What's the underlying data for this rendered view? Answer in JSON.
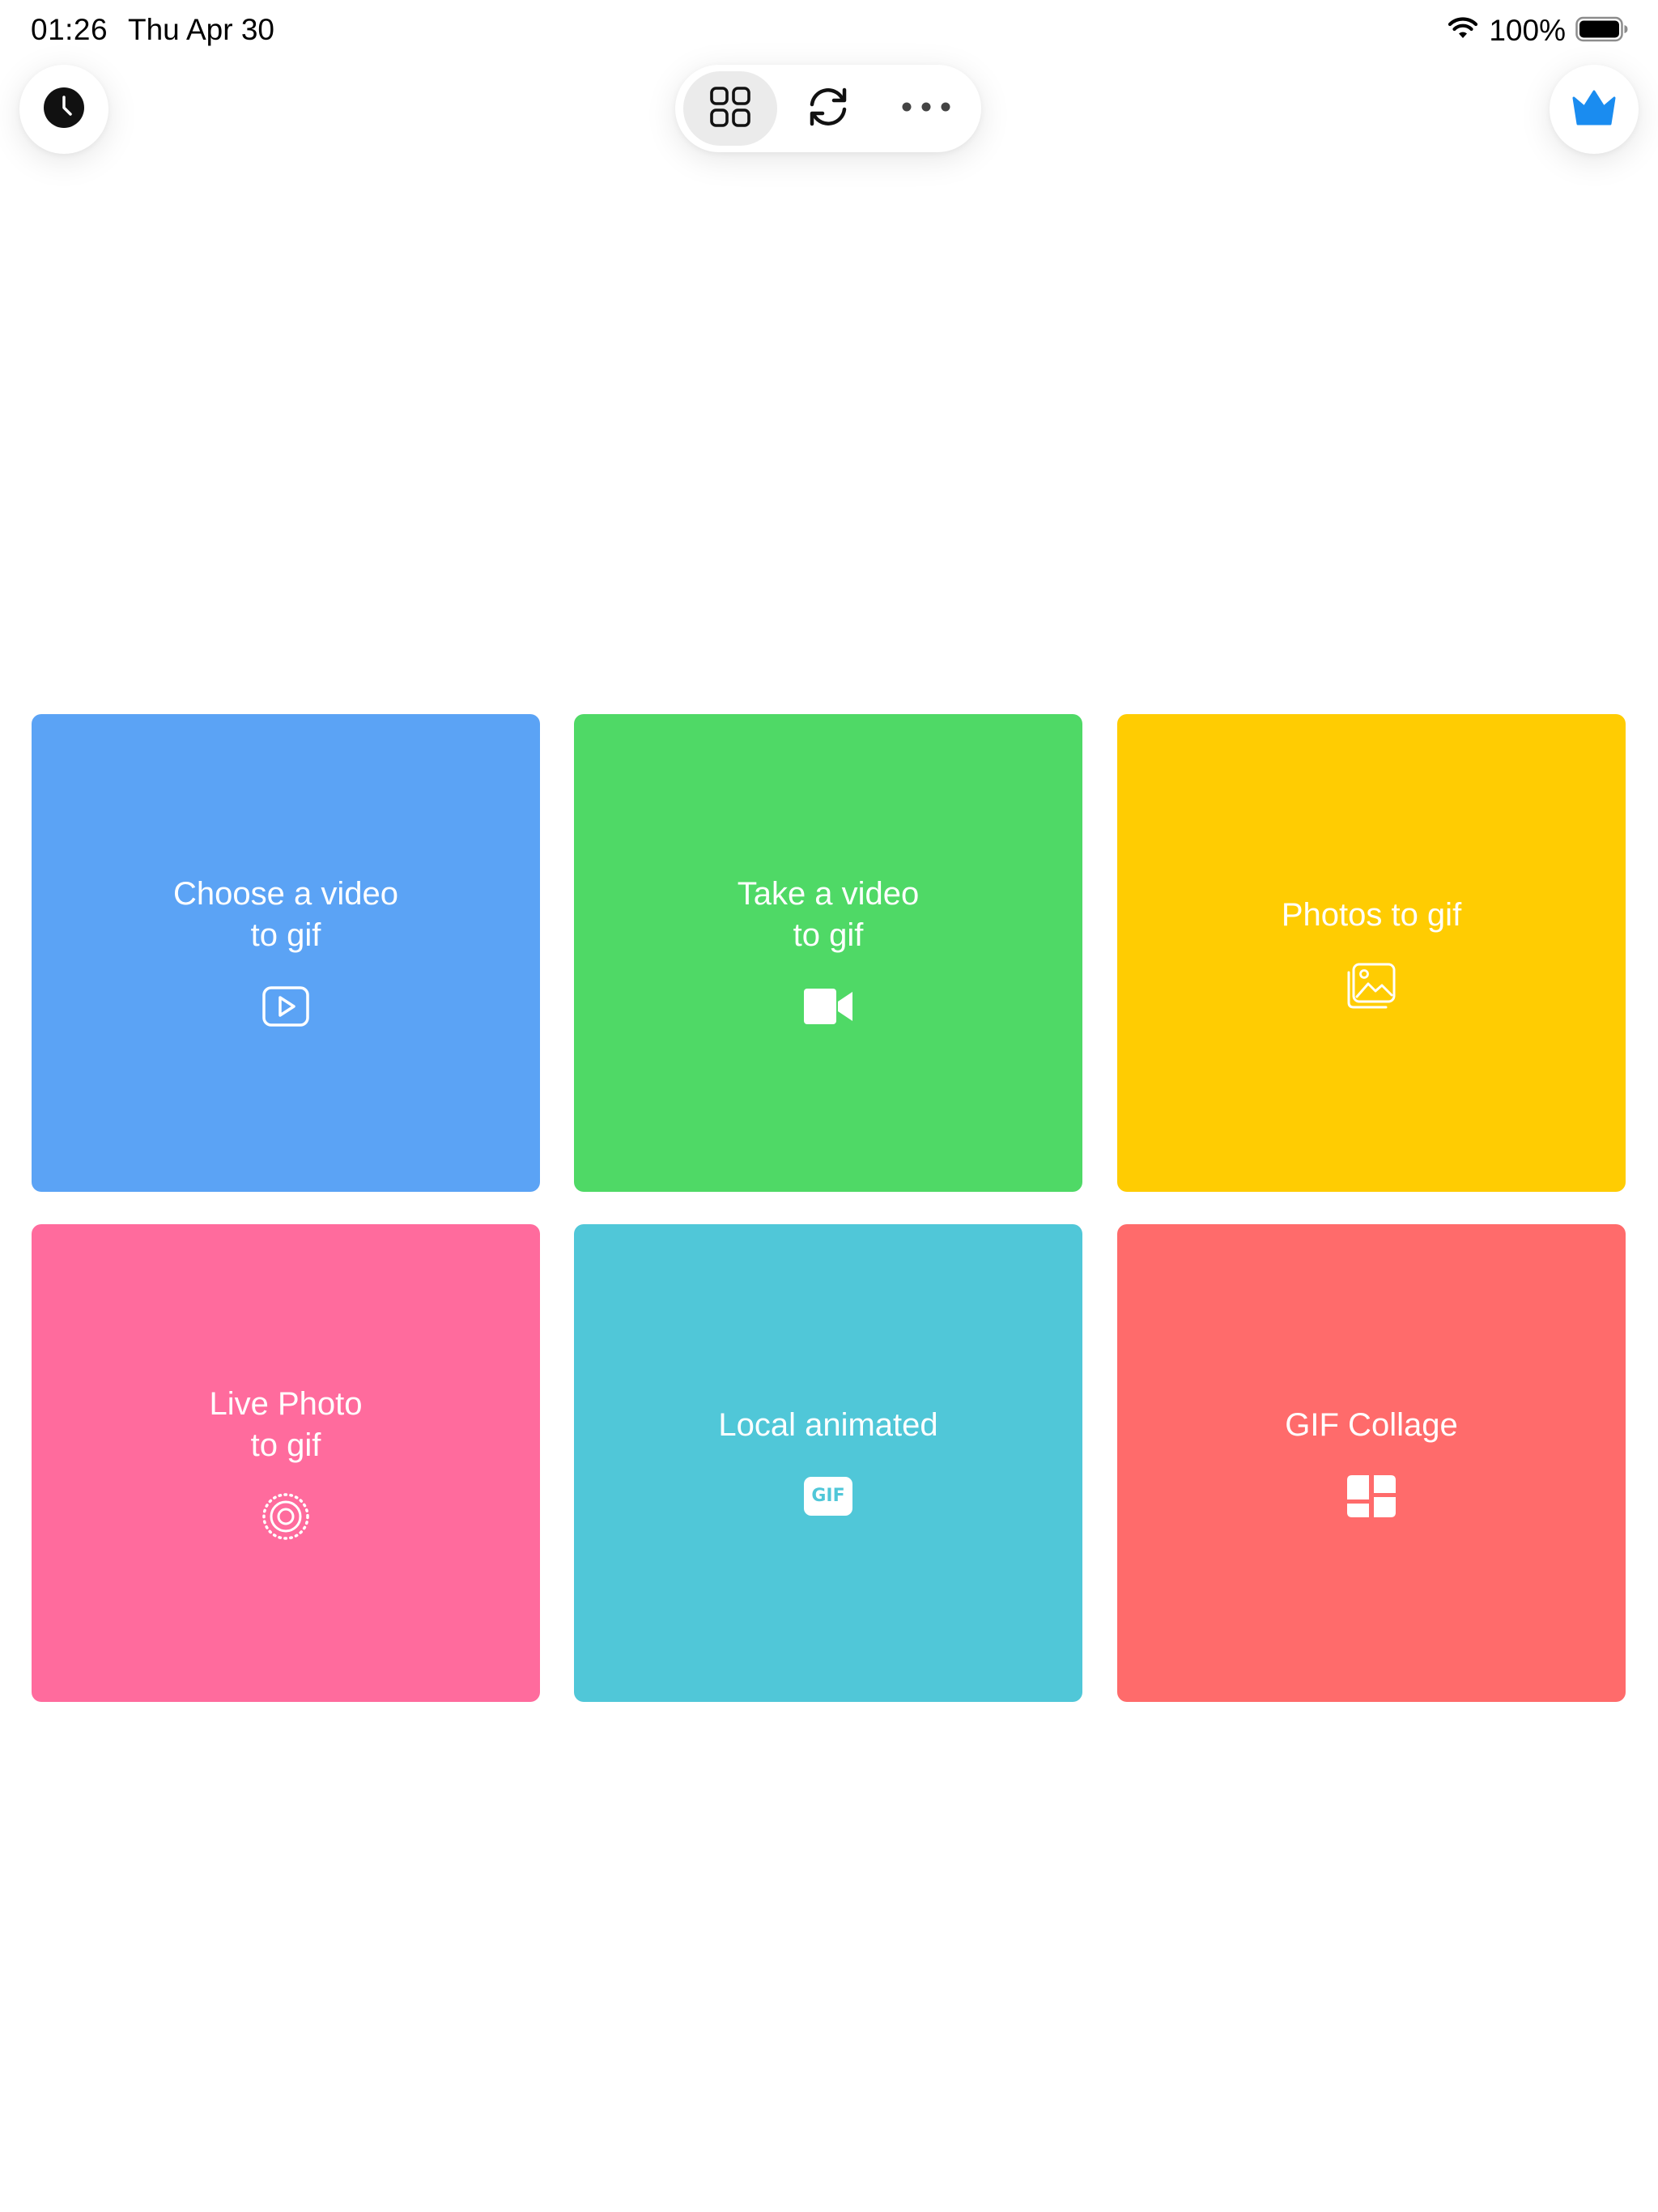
{
  "status_bar": {
    "time": "01:26",
    "date": "Thu Apr 30",
    "battery": "100%"
  },
  "top_bar": {
    "history_icon": "clock-icon",
    "premium_icon": "crown-icon",
    "premium_color": "#1a8cf0",
    "toolbar": [
      {
        "icon": "grid-icon",
        "active": true
      },
      {
        "icon": "refresh-icon",
        "active": false
      },
      {
        "icon": "more-icon",
        "active": false
      }
    ]
  },
  "tiles": [
    {
      "label": "Choose a video\nto gif",
      "icon": "play-video-icon",
      "color": "#5ba3f5"
    },
    {
      "label": "Take a video\nto gif",
      "icon": "video-camera-icon",
      "color": "#4fd966"
    },
    {
      "label": "Photos to gif",
      "icon": "photos-icon",
      "color": "#ffcc02"
    },
    {
      "label": "Live Photo\nto gif",
      "icon": "live-photo-icon",
      "color": "#ff6b9d"
    },
    {
      "label": "Local animated",
      "icon": "gif-badge-icon",
      "icon_text": "GIF",
      "color": "#50c7d8"
    },
    {
      "label": "GIF Collage",
      "icon": "collage-icon",
      "color": "#ff6b6b"
    }
  ]
}
